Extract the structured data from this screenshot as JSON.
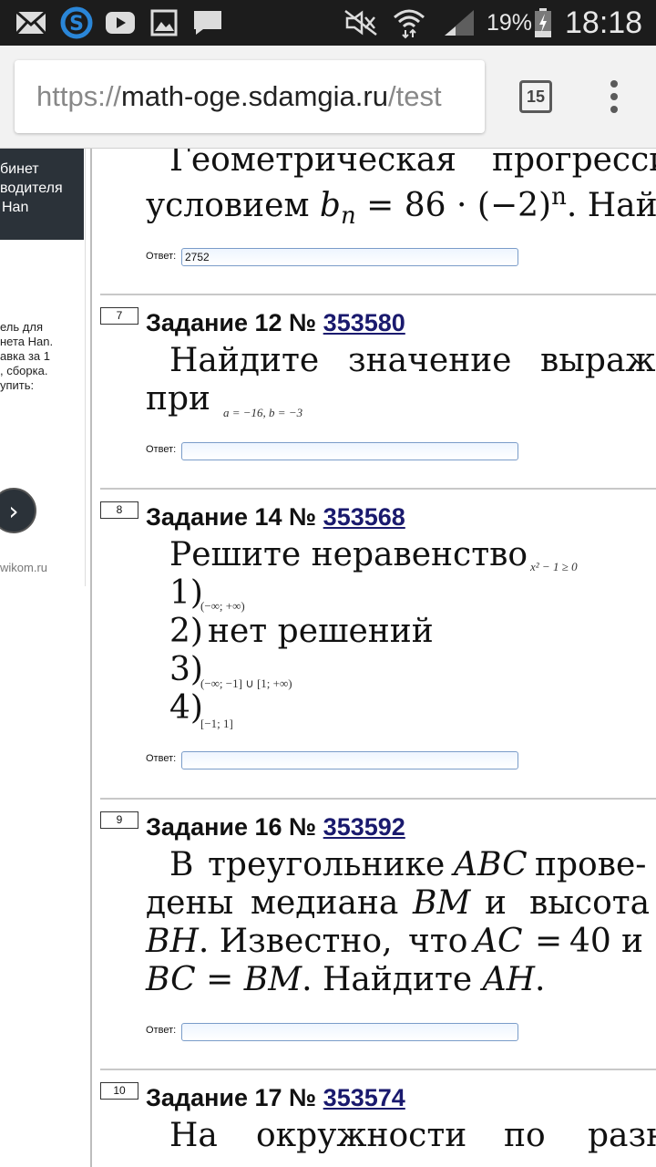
{
  "status_bar": {
    "battery": "19%",
    "time": "18:18",
    "left_icons": [
      "mail-icon",
      "skype-icon",
      "youtube-icon",
      "gallery-icon",
      "message-icon"
    ],
    "right_icons": [
      "mute-icon",
      "wifi-icon",
      "signal-icon",
      "battery-icon"
    ]
  },
  "browser": {
    "url_scheme": "https://",
    "url_host": "math-oge.sdamgia.ru",
    "url_path": "/test",
    "tab_count": "15"
  },
  "sidebar_ad": {
    "dark_lines": [
      "бинет",
      "водителя",
      "Han"
    ],
    "text_lines": [
      "ель для",
      "нета Han.",
      "авка за 1",
      ", сборка.",
      "упить:"
    ],
    "domain": "wikom.ru"
  },
  "prev_task": {
    "line1_word1": "Геометрическая",
    "line1_word2": "прогресси",
    "line2_pre": "условием",
    "line2_var": "b",
    "line2_sub": "n",
    "line2_eq": "= 86 · (−2)",
    "line2_sup": "n",
    "line2_post": ". Найди",
    "answer_label": "Ответ:",
    "answer_value": "2752"
  },
  "tasks": [
    {
      "num": "7",
      "title": "Задание 12 №",
      "link": "353580",
      "line1_words": [
        "Найдите",
        "значение",
        "выраж"
      ],
      "line2_word": "при",
      "line2_math": "a = −16, b = −3",
      "answer_label": "Ответ:",
      "answer_value": ""
    },
    {
      "num": "8",
      "title": "Задание 14 №",
      "link": "353568",
      "intro": "Решите неравенство",
      "intro_math": "x² − 1 ≥ 0",
      "options": [
        {
          "n": "1)",
          "text": "",
          "math": "(−∞; +∞)"
        },
        {
          "n": "2)",
          "text": "нет решений",
          "math": ""
        },
        {
          "n": "3)",
          "text": "",
          "math": "(−∞; −1] ∪ [1; +∞)"
        },
        {
          "n": "4)",
          "text": "",
          "math": "[−1; 1]"
        }
      ],
      "answer_label": "Ответ:",
      "answer_value": ""
    },
    {
      "num": "9",
      "title": "Задание 16 №",
      "link": "353592",
      "answer_label": "Ответ:",
      "answer_value": ""
    },
    {
      "num": "10",
      "title": "Задание 17 №",
      "link": "353574",
      "line1_words": [
        "На",
        "окружности",
        "по",
        "разн"
      ]
    }
  ],
  "task16_text": {
    "l1a": "В",
    "l1b": "треугольнике",
    "l1c": "ABC",
    "l1d": "прове-",
    "l2a": "дены",
    "l2b": "медиана",
    "l2c": "BM",
    "l2d": "и",
    "l2e": "высота",
    "l3a": "BH",
    "l3b": ". Известно,",
    "l3c": "что",
    "l3d": "AC",
    "l3e": "=",
    "l3f": "40",
    "l3g": "и",
    "l4a": "BC",
    "l4b": " = ",
    "l4c": "BM",
    "l4d": ". Найдите ",
    "l4e": "AH",
    "l4f": "."
  }
}
